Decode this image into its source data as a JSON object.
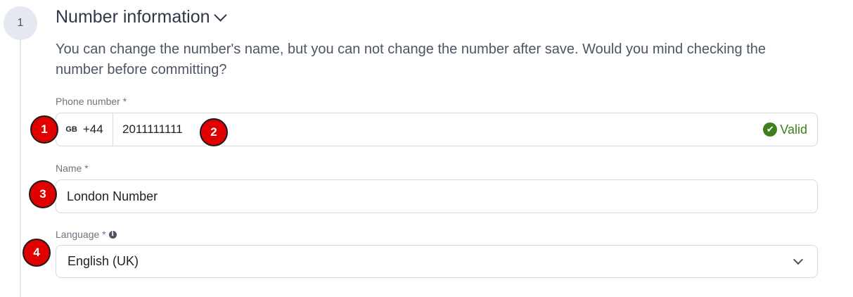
{
  "step": {
    "number": "1"
  },
  "section": {
    "title": "Number information",
    "description": "You can change the number's name, but you can not change the number after save. Would you mind checking the number before committing?"
  },
  "phone": {
    "label": "Phone number *",
    "country_code": "GB",
    "dial_code": "+44",
    "value": "2011111111",
    "status": "Valid",
    "status_icon": "check-circle-icon"
  },
  "name": {
    "label": "Name *",
    "value": "London Number"
  },
  "language": {
    "label": "Language *",
    "value": "English (UK)",
    "info_icon": "info-icon"
  },
  "annotations": [
    "1",
    "2",
    "3",
    "4"
  ],
  "colors": {
    "annotation_badge": "#e00000",
    "valid": "#3f7f1c",
    "step_circle": "#e3e8f1"
  }
}
